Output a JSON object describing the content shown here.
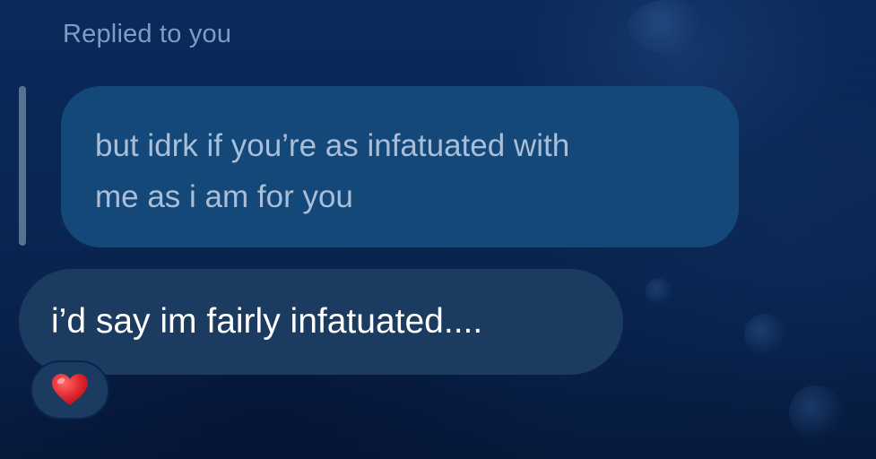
{
  "reply": {
    "label": "Replied to you",
    "quoted_text": "but idrk if you’re as infatuated with\nme as i am for you"
  },
  "message": {
    "text": "i’d say im fairly infatuated...."
  },
  "reaction": {
    "icon": "heart-icon",
    "color": "#e0282e"
  },
  "colors": {
    "background": "#0a2754",
    "quoted_bubble": "#144878",
    "message_bubble": "#1b3b61",
    "reply_label": "#7f9cc6"
  }
}
